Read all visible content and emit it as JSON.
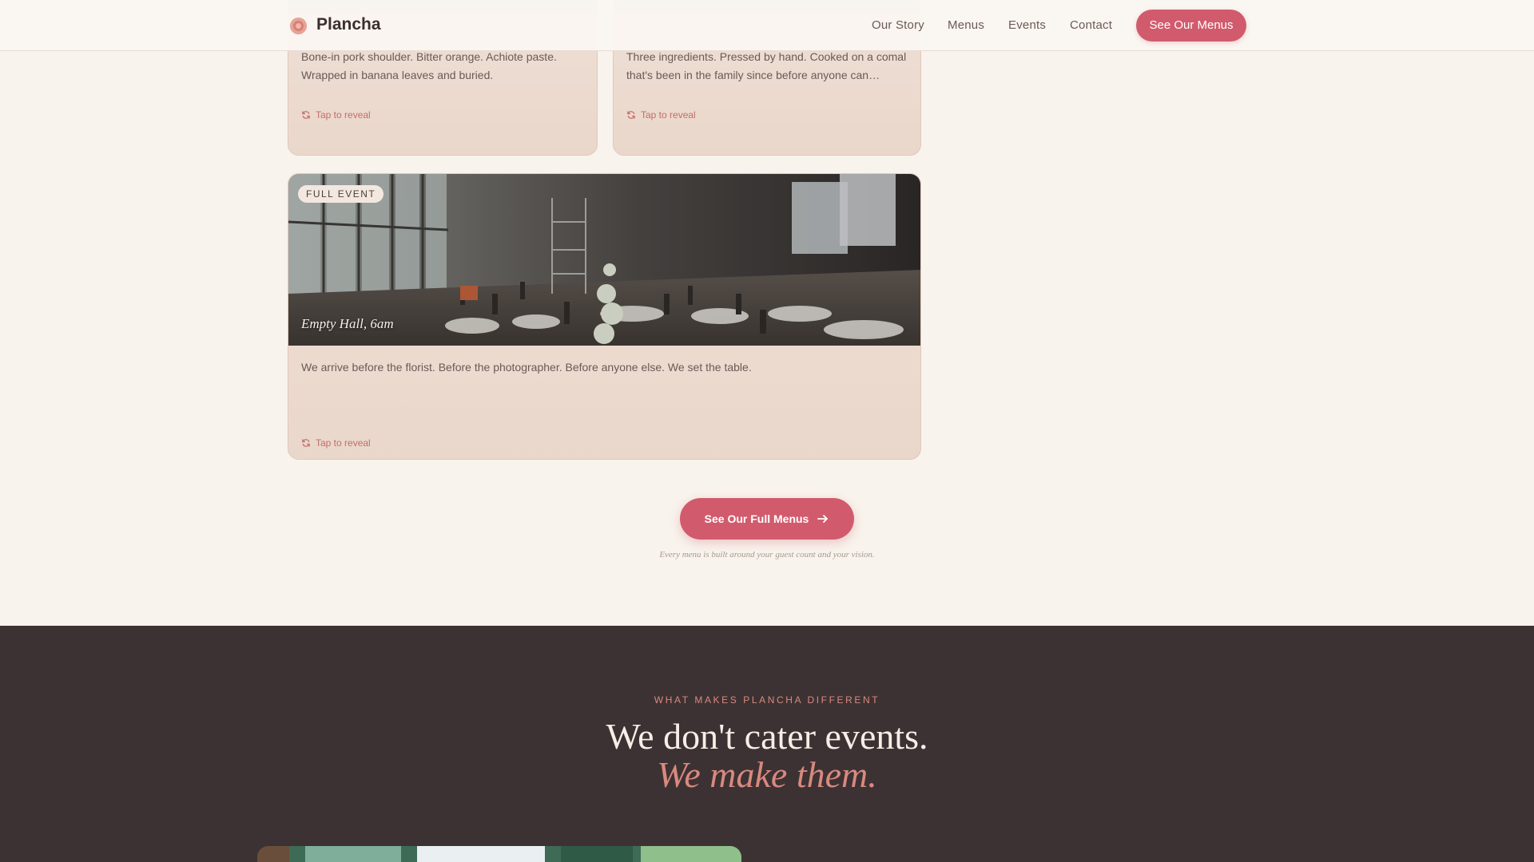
{
  "nav": {
    "brand": "Plancha",
    "links": [
      "Our Story",
      "Menus",
      "Events",
      "Contact"
    ],
    "cta": "See Our Menus"
  },
  "cards": [
    {
      "description": "Bone-in pork shoulder. Bitter orange. Achiote paste. Wrapped in banana leaves and buried.",
      "reveal": "Tap to reveal"
    },
    {
      "description": "Three ingredients. Pressed by hand. Cooked on a comal that's been in the family since before anyone can…",
      "reveal": "Tap to reveal"
    },
    {
      "badge": "FULL EVENT",
      "caption": "Empty Hall, 6am",
      "description": "We arrive before the florist. Before the photographer. Before anyone else. We set the table.",
      "reveal": "Tap to reveal"
    }
  ],
  "main_cta": {
    "label": "See Our Full Menus",
    "note": "Every menu is built around your guest count and your vision."
  },
  "difference": {
    "eyebrow": "WHAT MAKES PLANCHA DIFFERENT",
    "line1": "We don't cater events.",
    "line2": "We make them."
  },
  "colors": {
    "accent": "#d15b6c",
    "dark_section": "#3d3233",
    "highlight": "#d9897f",
    "page_bg": "#f8f3ec"
  }
}
